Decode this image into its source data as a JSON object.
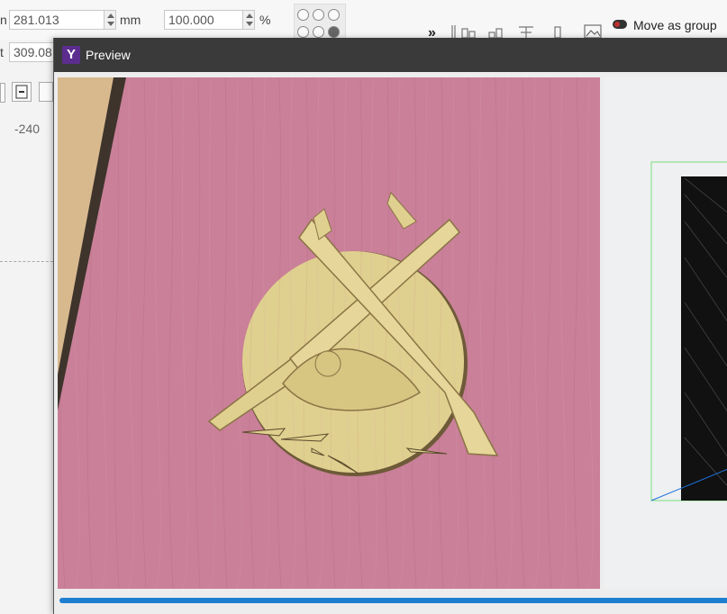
{
  "toolbar": {
    "width_label": "n",
    "width_value": "281.013",
    "width_unit": "mm",
    "height_label": "t",
    "height_value": "309.08",
    "scale_value": "100.000",
    "scale_unit": "%",
    "move_as_group": "Move as group"
  },
  "ruler": {
    "mark": "-240"
  },
  "window": {
    "title": "Preview",
    "app_icon": "Y"
  },
  "progress": {
    "fraction": 1.0
  },
  "colors": {
    "titlebar": "#3a3a3a",
    "wood": "#c98098",
    "carving": "#e0d08f",
    "progress": "#1e7fd1"
  }
}
